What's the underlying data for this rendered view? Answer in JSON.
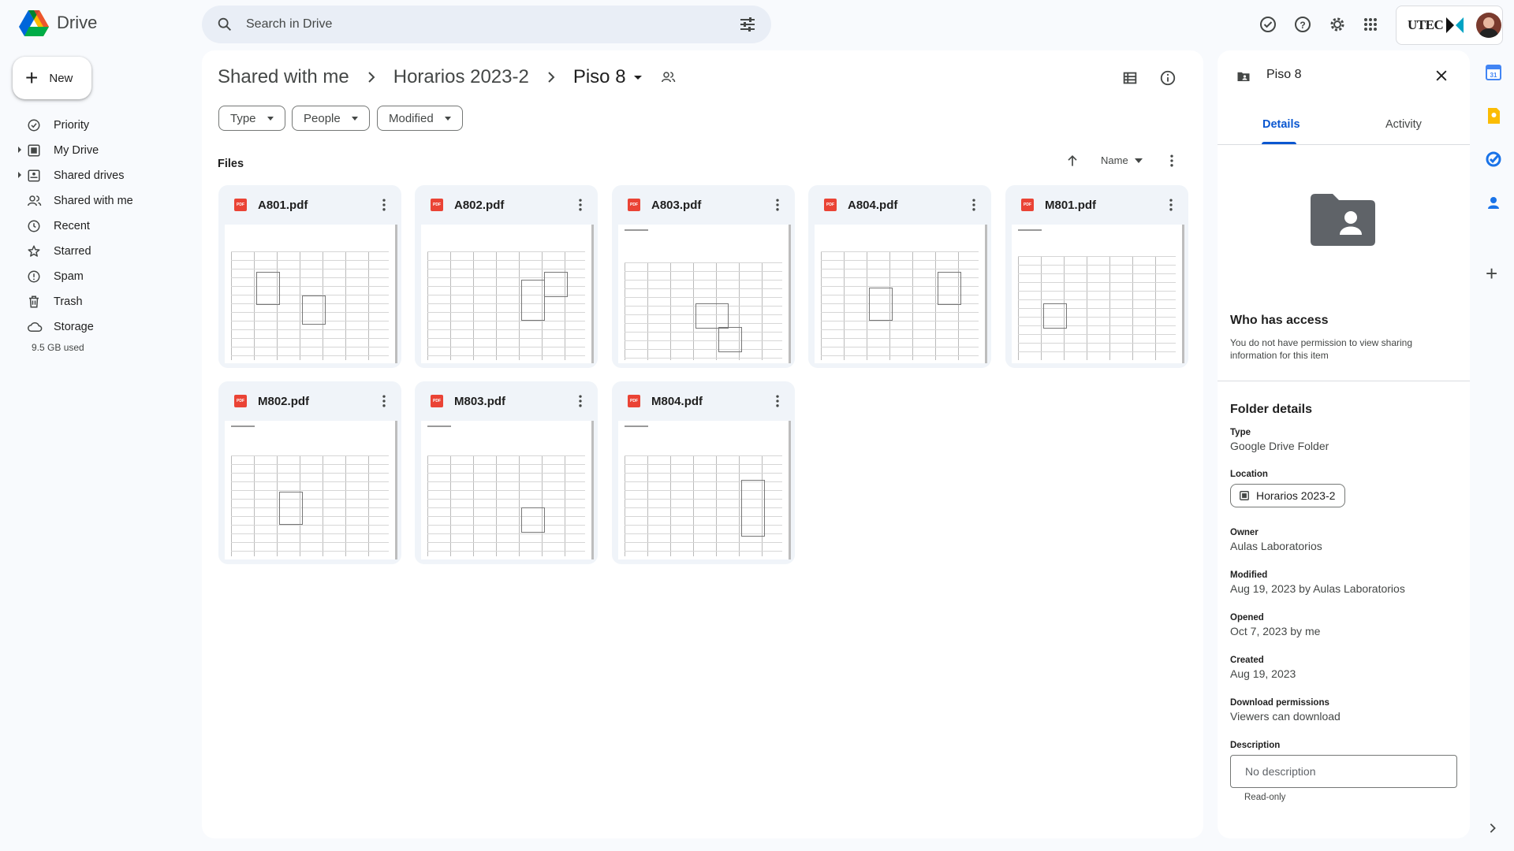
{
  "app": {
    "name": "Drive"
  },
  "search": {
    "placeholder": "Search in Drive"
  },
  "header_icons": [
    "offline-ready-icon",
    "help-icon",
    "settings-icon",
    "apps-grid-icon"
  ],
  "account": {
    "org_label": "UTEC"
  },
  "new_button": {
    "label": "New"
  },
  "sidebar": {
    "items": [
      {
        "label": "Priority",
        "icon": "priority-icon"
      },
      {
        "label": "My Drive",
        "icon": "my-drive-icon",
        "expandable": true
      },
      {
        "label": "Shared drives",
        "icon": "shared-drives-icon",
        "expandable": true
      },
      {
        "label": "Shared with me",
        "icon": "shared-with-me-icon"
      },
      {
        "label": "Recent",
        "icon": "clock-icon"
      },
      {
        "label": "Starred",
        "icon": "star-icon"
      },
      {
        "label": "Spam",
        "icon": "spam-icon"
      },
      {
        "label": "Trash",
        "icon": "trash-icon"
      },
      {
        "label": "Storage",
        "icon": "cloud-icon"
      }
    ],
    "storage_used": "9.5 GB used"
  },
  "breadcrumb": {
    "items": [
      "Shared with me",
      "Horarios 2023-2",
      "Piso 8"
    ]
  },
  "filters": {
    "chips": [
      "Type",
      "People",
      "Modified"
    ]
  },
  "files": {
    "heading": "Files",
    "sort_label": "Name",
    "items": [
      {
        "name": "A801.pdf"
      },
      {
        "name": "A802.pdf"
      },
      {
        "name": "A803.pdf"
      },
      {
        "name": "A804.pdf"
      },
      {
        "name": "M801.pdf"
      },
      {
        "name": "M802.pdf"
      },
      {
        "name": "M803.pdf"
      },
      {
        "name": "M804.pdf"
      }
    ]
  },
  "details": {
    "title": "Piso 8",
    "tabs": [
      "Details",
      "Activity"
    ],
    "who_has_access": {
      "heading": "Who has access",
      "message": "You do not have permission to view sharing information for this item"
    },
    "folder_details": {
      "heading": "Folder details",
      "type_label": "Type",
      "type_value": "Google Drive Folder",
      "location_label": "Location",
      "location_value": "Horarios 2023-2",
      "owner_label": "Owner",
      "owner_value": "Aulas Laboratorios",
      "modified_label": "Modified",
      "modified_value": "Aug 19, 2023 by Aulas Laboratorios",
      "opened_label": "Opened",
      "opened_value": "Oct 7, 2023 by me",
      "created_label": "Created",
      "created_value": "Aug 19, 2023",
      "download_label": "Download permissions",
      "download_value": "Viewers can download",
      "description_label": "Description",
      "description_placeholder": "No description",
      "readonly_note": "Read-only"
    }
  },
  "colors": {
    "accent": "#0b57d0",
    "pdf_red": "#ea4335",
    "surface": "#f8fafd"
  }
}
